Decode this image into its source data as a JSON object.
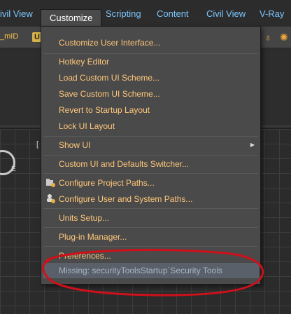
{
  "menubar": {
    "items": [
      {
        "label": "ivil View"
      },
      {
        "label": "Customize"
      },
      {
        "label": "Scripting"
      },
      {
        "label": "Content"
      },
      {
        "label": "Civil View"
      },
      {
        "label": "V-Ray"
      }
    ]
  },
  "toolbar": {
    "label": "_mID",
    "u_icon_text": "U"
  },
  "viewport": {
    "bracket_text": "[",
    "compass_letter": "E"
  },
  "dropdown": {
    "items": [
      {
        "label": "Customize User Interface..."
      },
      {
        "label": "Hotkey Editor"
      },
      {
        "label": "Load Custom UI Scheme..."
      },
      {
        "label": "Save Custom UI Scheme..."
      },
      {
        "label": "Revert to Startup Layout"
      },
      {
        "label": "Lock UI Layout"
      },
      {
        "label": "Show UI"
      },
      {
        "label": "Custom UI and Defaults Switcher..."
      },
      {
        "label": "Configure Project Paths..."
      },
      {
        "label": "Configure User and System Paths..."
      },
      {
        "label": "Units Setup..."
      },
      {
        "label": "Plug-in Manager..."
      },
      {
        "label": "Preferences..."
      },
      {
        "label": "Missing: securityToolsStartup`Security Tools"
      }
    ]
  },
  "colors": {
    "menu_text": "#ffc77a",
    "menubar_text": "#7cc7ff",
    "annotation": "#d0101a"
  }
}
